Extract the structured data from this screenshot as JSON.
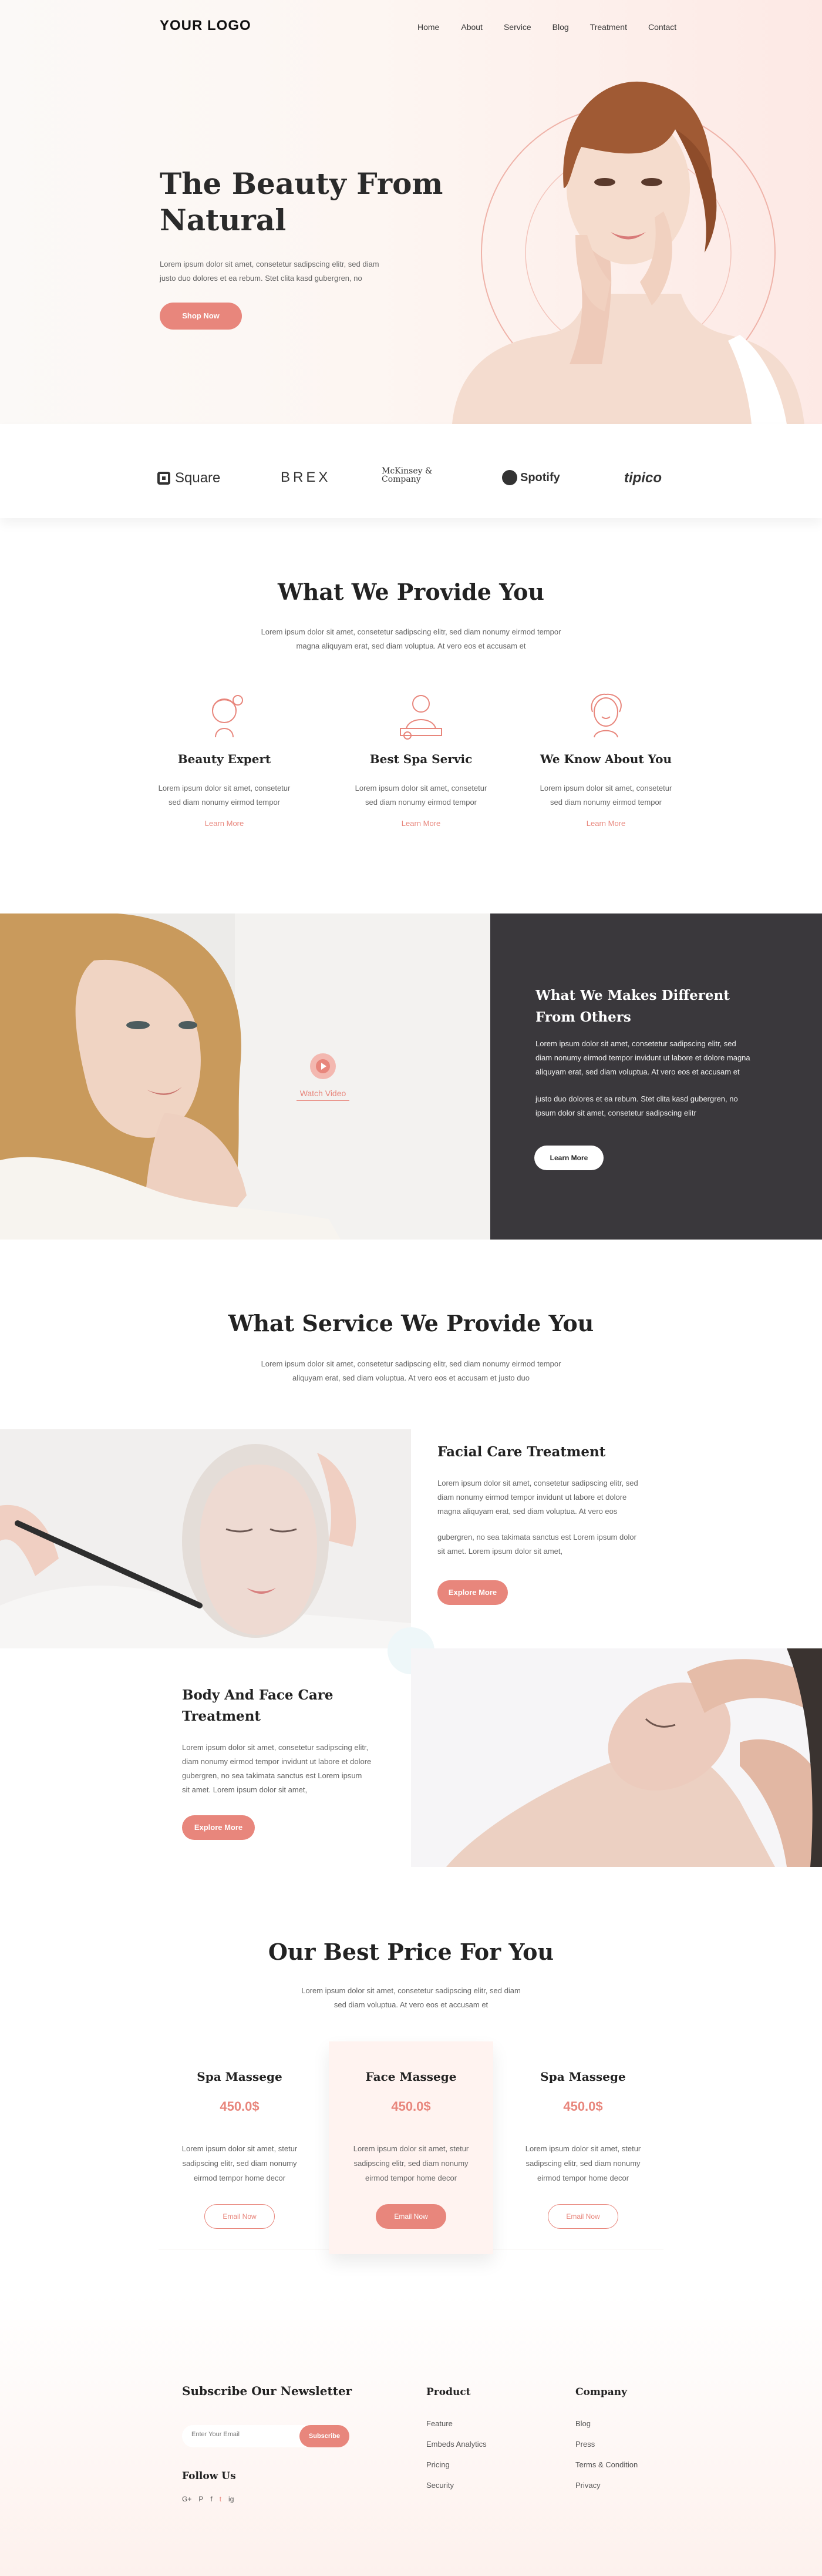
{
  "nav": {
    "logo": "YOUR LOGO",
    "items": [
      "Home",
      "About",
      "Service",
      "Blog",
      "Treatment",
      "Contact"
    ]
  },
  "hero": {
    "title_line1": "The Beauty From",
    "title_line2": "Natural",
    "text_line1": "Lorem ipsum dolor sit amet, consetetur sadipscing elitr, sed diam",
    "text_line2": "justo duo dolores et ea rebum. Stet clita kasd gubergren, no",
    "button": "Shop Now"
  },
  "logos": [
    "Square",
    "BREX",
    "McKinsey & Company",
    "Spotify",
    "tipico"
  ],
  "provide": {
    "title": "What We Provide You",
    "text_line1": "Lorem ipsum dolor sit amet, consetetur sadipscing elitr, sed diam nonumy eirmod tempor",
    "text_line2": "magna aliquyam erat, sed diam voluptua. At vero eos et accusam et",
    "cards": [
      {
        "icon": "beauty-expert-icon",
        "title": "Beauty Expert",
        "line1": "Lorem ipsum dolor sit amet, consetetur",
        "line2": "sed diam nonumy eirmod tempor",
        "link": "Learn More"
      },
      {
        "icon": "spa-service-icon",
        "title": "Best Spa Servic",
        "line1": "Lorem ipsum dolor sit amet, consetetur",
        "line2": "sed diam nonumy eirmod tempor",
        "link": "Learn More"
      },
      {
        "icon": "know-about-icon",
        "title": "We Know About You",
        "line1": "Lorem ipsum dolor sit amet, consetetur",
        "line2": "sed diam nonumy eirmod tempor",
        "link": "Learn More"
      }
    ]
  },
  "different": {
    "watch": "Watch Video",
    "title_line1": "What We Makes Different",
    "title_line2": "From Others",
    "p1_line1": "Lorem ipsum dolor sit amet, consetetur sadipscing elitr, sed",
    "p1_line2": "diam nonumy eirmod tempor invidunt ut labore et dolore magna",
    "p1_line3": "aliquyam erat, sed diam voluptua. At vero eos et accusam et",
    "p2_line1": "justo duo dolores et ea rebum. Stet clita kasd gubergren, no",
    "p2_line2": "ipsum dolor sit amet, consetetur sadipscing elitr",
    "button": "Learn More"
  },
  "services": {
    "title": "What Service We Provide You",
    "text_line1": "Lorem ipsum dolor sit amet, consetetur sadipscing elitr, sed diam nonumy eirmod tempor",
    "text_line2": "aliquyam erat, sed diam voluptua. At vero eos et accusam et justo duo",
    "facial": {
      "title": "Facial Care Treatment",
      "l1": "Lorem ipsum dolor sit amet, consetetur sadipscing elitr, sed",
      "l2": "diam nonumy eirmod tempor invidunt ut labore et dolore",
      "l3": "magna aliquyam erat, sed diam voluptua. At vero eos",
      "l4": "gubergren, no sea takimata sanctus est Lorem ipsum dolor",
      "l5": "sit amet. Lorem ipsum dolor sit amet,",
      "button": "Explore More"
    },
    "body": {
      "title_line1": "Body And Face Care",
      "title_line2": "Treatment",
      "l1": "Lorem ipsum dolor sit amet, consetetur sadipscing elitr,",
      "l2": "diam nonumy eirmod tempor invidunt ut labore et dolore",
      "l3": "gubergren, no sea takimata sanctus est Lorem ipsum",
      "l4": "sit amet. Lorem ipsum dolor sit amet,",
      "button": "Explore More"
    }
  },
  "pricing": {
    "title": "Our Best Price For You",
    "text_line1": "Lorem ipsum dolor sit amet, consetetur sadipscing elitr, sed diam",
    "text_line2": "sed diam voluptua. At vero eos et accusam et",
    "cards": [
      {
        "title": "Spa Massege",
        "price": "450.0$",
        "l1": "Lorem ipsum dolor sit amet, stetur",
        "l2": "sadipscing elitr, sed diam nonumy",
        "l3": "eirmod tempor home decor",
        "button": "Email Now"
      },
      {
        "title": "Face Massege",
        "price": "450.0$",
        "l1": "Lorem ipsum dolor sit amet, stetur",
        "l2": "sadipscing elitr, sed diam nonumy",
        "l3": "eirmod tempor home decor",
        "button": "Email Now"
      },
      {
        "title": "Spa Massege",
        "price": "450.0$",
        "l1": "Lorem ipsum dolor sit amet, stetur",
        "l2": "sadipscing elitr, sed diam nonumy",
        "l3": "eirmod tempor home decor",
        "button": "Email Now"
      }
    ]
  },
  "footer": {
    "newsletter_title": "Subscribe Our Newsletter",
    "email_placeholder": "Enter Your Email",
    "subscribe": "Subscribe",
    "follow": "Follow Us",
    "social": [
      "G+",
      "P",
      "f",
      "t",
      "ig"
    ],
    "product_title": "Product",
    "product_links": [
      "Feature",
      "Embeds Analytics",
      "Pricing",
      "Security"
    ],
    "company_title": "Company",
    "company_links": [
      "Blog",
      "Press",
      "Terms & Condition",
      "Privacy"
    ]
  },
  "colors": {
    "accent": "#e8867c",
    "dark_panel": "#3a383c"
  }
}
